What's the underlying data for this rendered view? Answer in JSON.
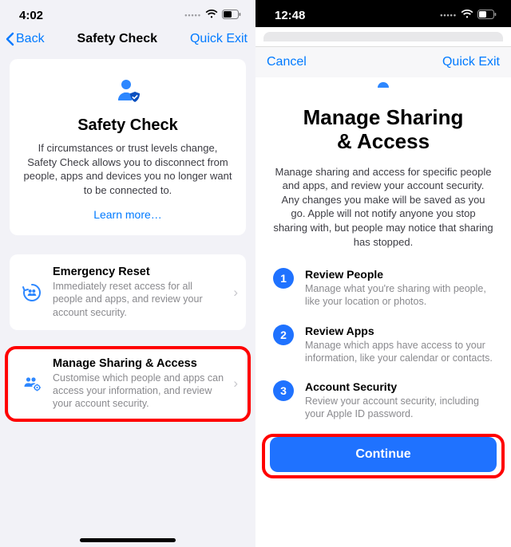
{
  "left": {
    "status_time": "4:02",
    "nav_back": "Back",
    "nav_title": "Safety Check",
    "nav_quick_exit": "Quick Exit",
    "hero_title": "Safety Check",
    "hero_body": "If circumstances or trust levels change, Safety Check allows you to disconnect from people, apps and devices you no longer want to be connected to.",
    "learn_more": "Learn more…",
    "emergency_title": "Emergency Reset",
    "emergency_body": "Immediately reset access for all people and apps, and review your account security.",
    "manage_title": "Manage Sharing & Access",
    "manage_body": "Customise which people and apps can access your information, and review your account security."
  },
  "right": {
    "status_time": "12:48",
    "nav_cancel": "Cancel",
    "nav_quick_exit": "Quick Exit",
    "title_l1": "Manage Sharing",
    "title_l2": "& Access",
    "desc": "Manage sharing and access for specific people and apps, and review your account security. Any changes you make will be saved as you go. Apple will not notify anyone you stop sharing with, but people may notice that sharing has stopped.",
    "steps": [
      {
        "n": "1",
        "title": "Review People",
        "body": "Manage what you're sharing with people, like your location or photos."
      },
      {
        "n": "2",
        "title": "Review Apps",
        "body": "Manage which apps have access to your information, like your calendar or contacts."
      },
      {
        "n": "3",
        "title": "Account Security",
        "body": "Review your account security, including your Apple ID password."
      }
    ],
    "continue": "Continue"
  }
}
